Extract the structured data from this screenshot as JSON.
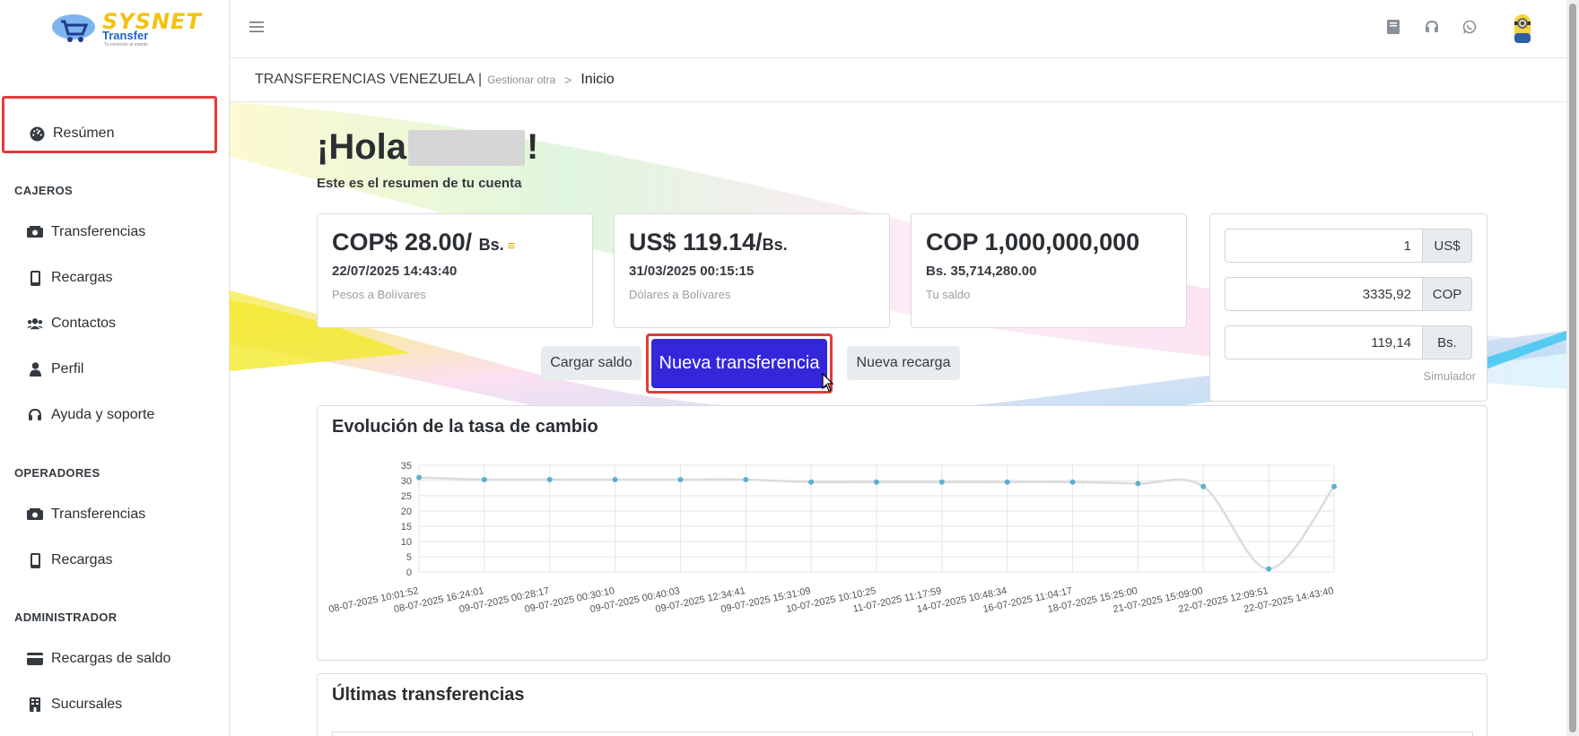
{
  "brand": {
    "name": "SYSNET",
    "sub": "Transfer",
    "tagline": "Tu conexión al mundo",
    "colors": {
      "accent": "#f4c20d",
      "blue": "#1e64c8"
    }
  },
  "sidebar": {
    "active_item": {
      "label": "Resúmen",
      "icon": "dashboard-icon"
    },
    "sections": [
      {
        "title": "CAJEROS",
        "items": [
          {
            "label": "Transferencias",
            "icon": "money-icon"
          },
          {
            "label": "Recargas",
            "icon": "phone-icon"
          },
          {
            "label": "Contactos",
            "icon": "users-icon"
          },
          {
            "label": "Perfil",
            "icon": "user-icon"
          },
          {
            "label": "Ayuda y soporte",
            "icon": "headset-icon"
          }
        ]
      },
      {
        "title": "OPERADORES",
        "items": [
          {
            "label": "Transferencias",
            "icon": "money-icon"
          },
          {
            "label": "Recargas",
            "icon": "phone-icon"
          }
        ]
      },
      {
        "title": "ADMINISTRADOR",
        "items": [
          {
            "label": "Recargas de saldo",
            "icon": "card-icon"
          },
          {
            "label": "Sucursales",
            "icon": "building-icon"
          }
        ]
      }
    ]
  },
  "topbar": {
    "icons": [
      "book-icon",
      "headset-icon",
      "whatsapp-icon"
    ],
    "avatar": "minion-avatar"
  },
  "breadcrumb": {
    "section": "TRANSFERENCIAS VENEZUELA |",
    "manage": "Gestionar otra",
    "separator": ">",
    "current": "Inicio"
  },
  "greeting": {
    "prefix": "¡Hola",
    "suffix": "!",
    "subtitle": "Este es el resumen de tu cuenta"
  },
  "cards": [
    {
      "big": "COP$ 28.00/",
      "unit": "Bs.",
      "date": "22/07/2025 14:43:40",
      "label": "Pesos a Bolívares"
    },
    {
      "big": "US$ 119.14/",
      "unit": "Bs.",
      "date": "31/03/2025 00:15:15",
      "label": "Dólares a Bolívares"
    },
    {
      "big": "COP 1,000,000,000",
      "unit": "",
      "date": "Bs. 35,714,280.00",
      "label": "Tu saldo"
    }
  ],
  "simulator": {
    "rows": [
      {
        "value": "1",
        "unit": "US$"
      },
      {
        "value": "3335,92",
        "unit": "COP"
      },
      {
        "value": "119,14",
        "unit": "Bs."
      }
    ],
    "label": "Simulador"
  },
  "actions": {
    "load": "Cargar saldo",
    "new_transfer": "Nueva transferencia",
    "new_recharge": "Nueva recarga"
  },
  "chart_title": "Evolución de la tasa de cambio",
  "last_title": "Últimas transferencias",
  "chart_data": {
    "type": "line",
    "title": "Evolución de la tasa de cambio",
    "xlabel": "",
    "ylabel": "",
    "ylim": [
      0,
      35
    ],
    "yticks": [
      0,
      5,
      10,
      15,
      20,
      25,
      30,
      35
    ],
    "grid": true,
    "categories": [
      "08-07-2025 10:01:52",
      "08-07-2025 16:24:01",
      "09-07-2025 00:28:17",
      "09-07-2025 00:30:10",
      "09-07-2025 00:40:03",
      "09-07-2025 12:34:41",
      "09-07-2025 15:31:09",
      "10-07-2025 10:10:25",
      "11-07-2025 11:17:59",
      "14-07-2025 10:48:34",
      "16-07-2025 11:04:17",
      "18-07-2025 15:25:00",
      "21-07-2025 15:09:00",
      "22-07-2025 12:09:51",
      "22-07-2025 14:43:40"
    ],
    "series": [
      {
        "values": [
          31,
          30.3,
          30.3,
          30.3,
          30.3,
          30.3,
          29.5,
          29.5,
          29.5,
          29.5,
          29.5,
          29,
          28,
          1,
          28
        ],
        "color": "#5bb0d0"
      }
    ]
  }
}
